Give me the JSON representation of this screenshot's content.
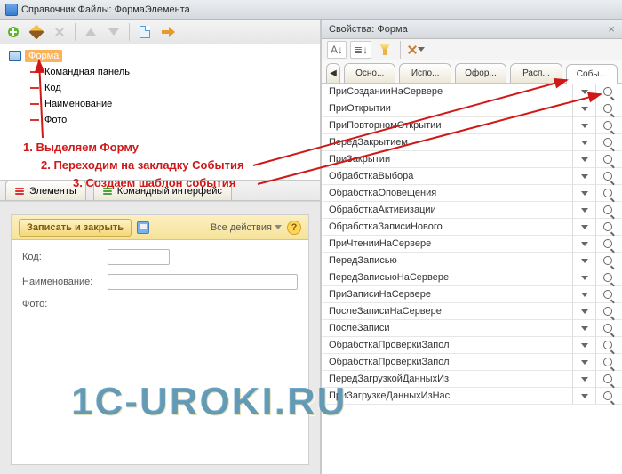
{
  "window_title": "Справочник Файлы: ФормаЭлемента",
  "tree": {
    "root": "Форма",
    "items": [
      "Командная панель",
      "Код",
      "Наименование",
      "Фото"
    ]
  },
  "annotations": {
    "a1": "1. Выделяем Форму",
    "a2": "2. Переходим на закладку События",
    "a3": "3. Создаем шаблон события"
  },
  "bottom_tabs": {
    "elements": "Элементы",
    "cmd": "Командный интерфейс"
  },
  "form_preview": {
    "save_close": "Записать и закрыть",
    "all_actions": "Все действия",
    "code": "Код:",
    "name": "Наименование:",
    "photo": "Фото:"
  },
  "right": {
    "title": "Свойства: Форма",
    "tabs": [
      "Осно...",
      "Испо...",
      "Офор...",
      "Расп...",
      "Собы..."
    ],
    "props": [
      "ПриСозданииНаСервере",
      "ПриОткрытии",
      "ПриПовторномОткрытии",
      "ПередЗакрытием",
      "ПриЗакрытии",
      "ОбработкаВыбора",
      "ОбработкаОповещения",
      "ОбработкаАктивизации",
      "ОбработкаЗаписиНового",
      "ПриЧтенииНаСервере",
      "ПередЗаписью",
      "ПередЗаписьюНаСервере",
      "ПриЗаписиНаСервере",
      "ПослеЗаписиНаСервере",
      "ПослеЗаписи",
      "ОбработкаПроверкиЗапол",
      "ОбработкаПроверкиЗапол",
      "ПередЗагрузкойДанныхИз",
      "ПриЗагрузкеДанныхИзНас"
    ]
  },
  "watermark": "1C-UROKI.RU"
}
